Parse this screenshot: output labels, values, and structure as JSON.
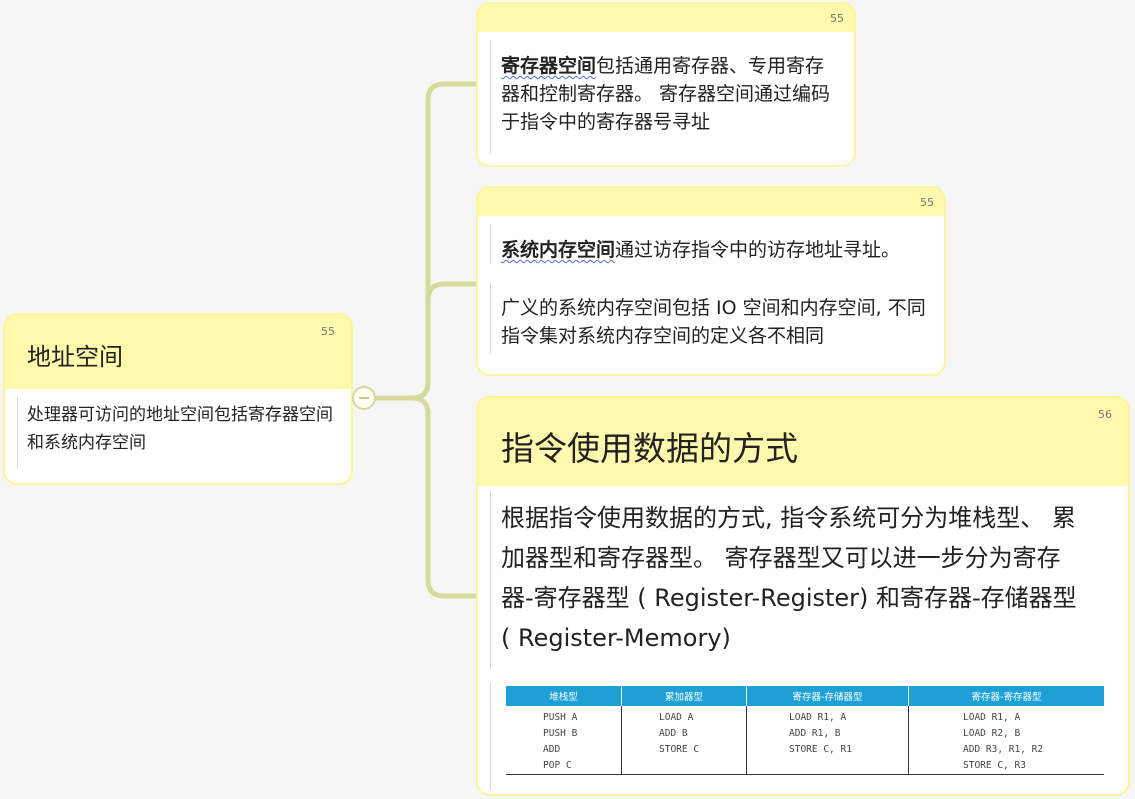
{
  "left_card": {
    "number": "55",
    "title": "地址空间",
    "text": "处理器可访问的地址空间包括寄存器空间和系统内存空间"
  },
  "card1": {
    "number": "55",
    "bold": "寄存器空间",
    "text": "包括通用寄存器、专用寄存器和控制寄存器。 寄存器空间通过编码于指令中的寄存器号寻址"
  },
  "card2": {
    "number": "55",
    "bold": "系统内存空间",
    "text1": "通过访存指令中的访存地址寻址。",
    "text2": "广义的系统内存空间包括 IO 空间和内存空间, 不同指令集对系统内存空间的定义各不相同"
  },
  "card3": {
    "number": "56",
    "title": "指令使用数据的方式",
    "text": "根据指令使用数据的方式, 指令系统可分为堆栈型、 累加器型和寄存器型。 寄存器型又可以进一步分为寄存器-寄存器型 ( Register-Register) 和寄存器-存储器型 ( Register-Memory)",
    "table": {
      "headers": [
        "堆栈型",
        "累加器型",
        "寄存器-存储器型",
        "寄存器-寄存器型"
      ],
      "columns": [
        [
          "PUSH A",
          "PUSH B",
          "ADD",
          "POP C"
        ],
        [
          "LOAD A",
          "ADD B",
          "STORE C"
        ],
        [
          "LOAD R1, A",
          "ADD R1, B",
          "STORE C, R1"
        ],
        [
          "LOAD R1, A",
          "LOAD R2, B",
          "ADD R3, R1, R2",
          "STORE C, R3"
        ]
      ]
    }
  },
  "colors": {
    "card_header": "#fff9ad",
    "card_border": "#fdf59a",
    "connector": "#d4d79e",
    "table_header": "#1ea0d7"
  }
}
